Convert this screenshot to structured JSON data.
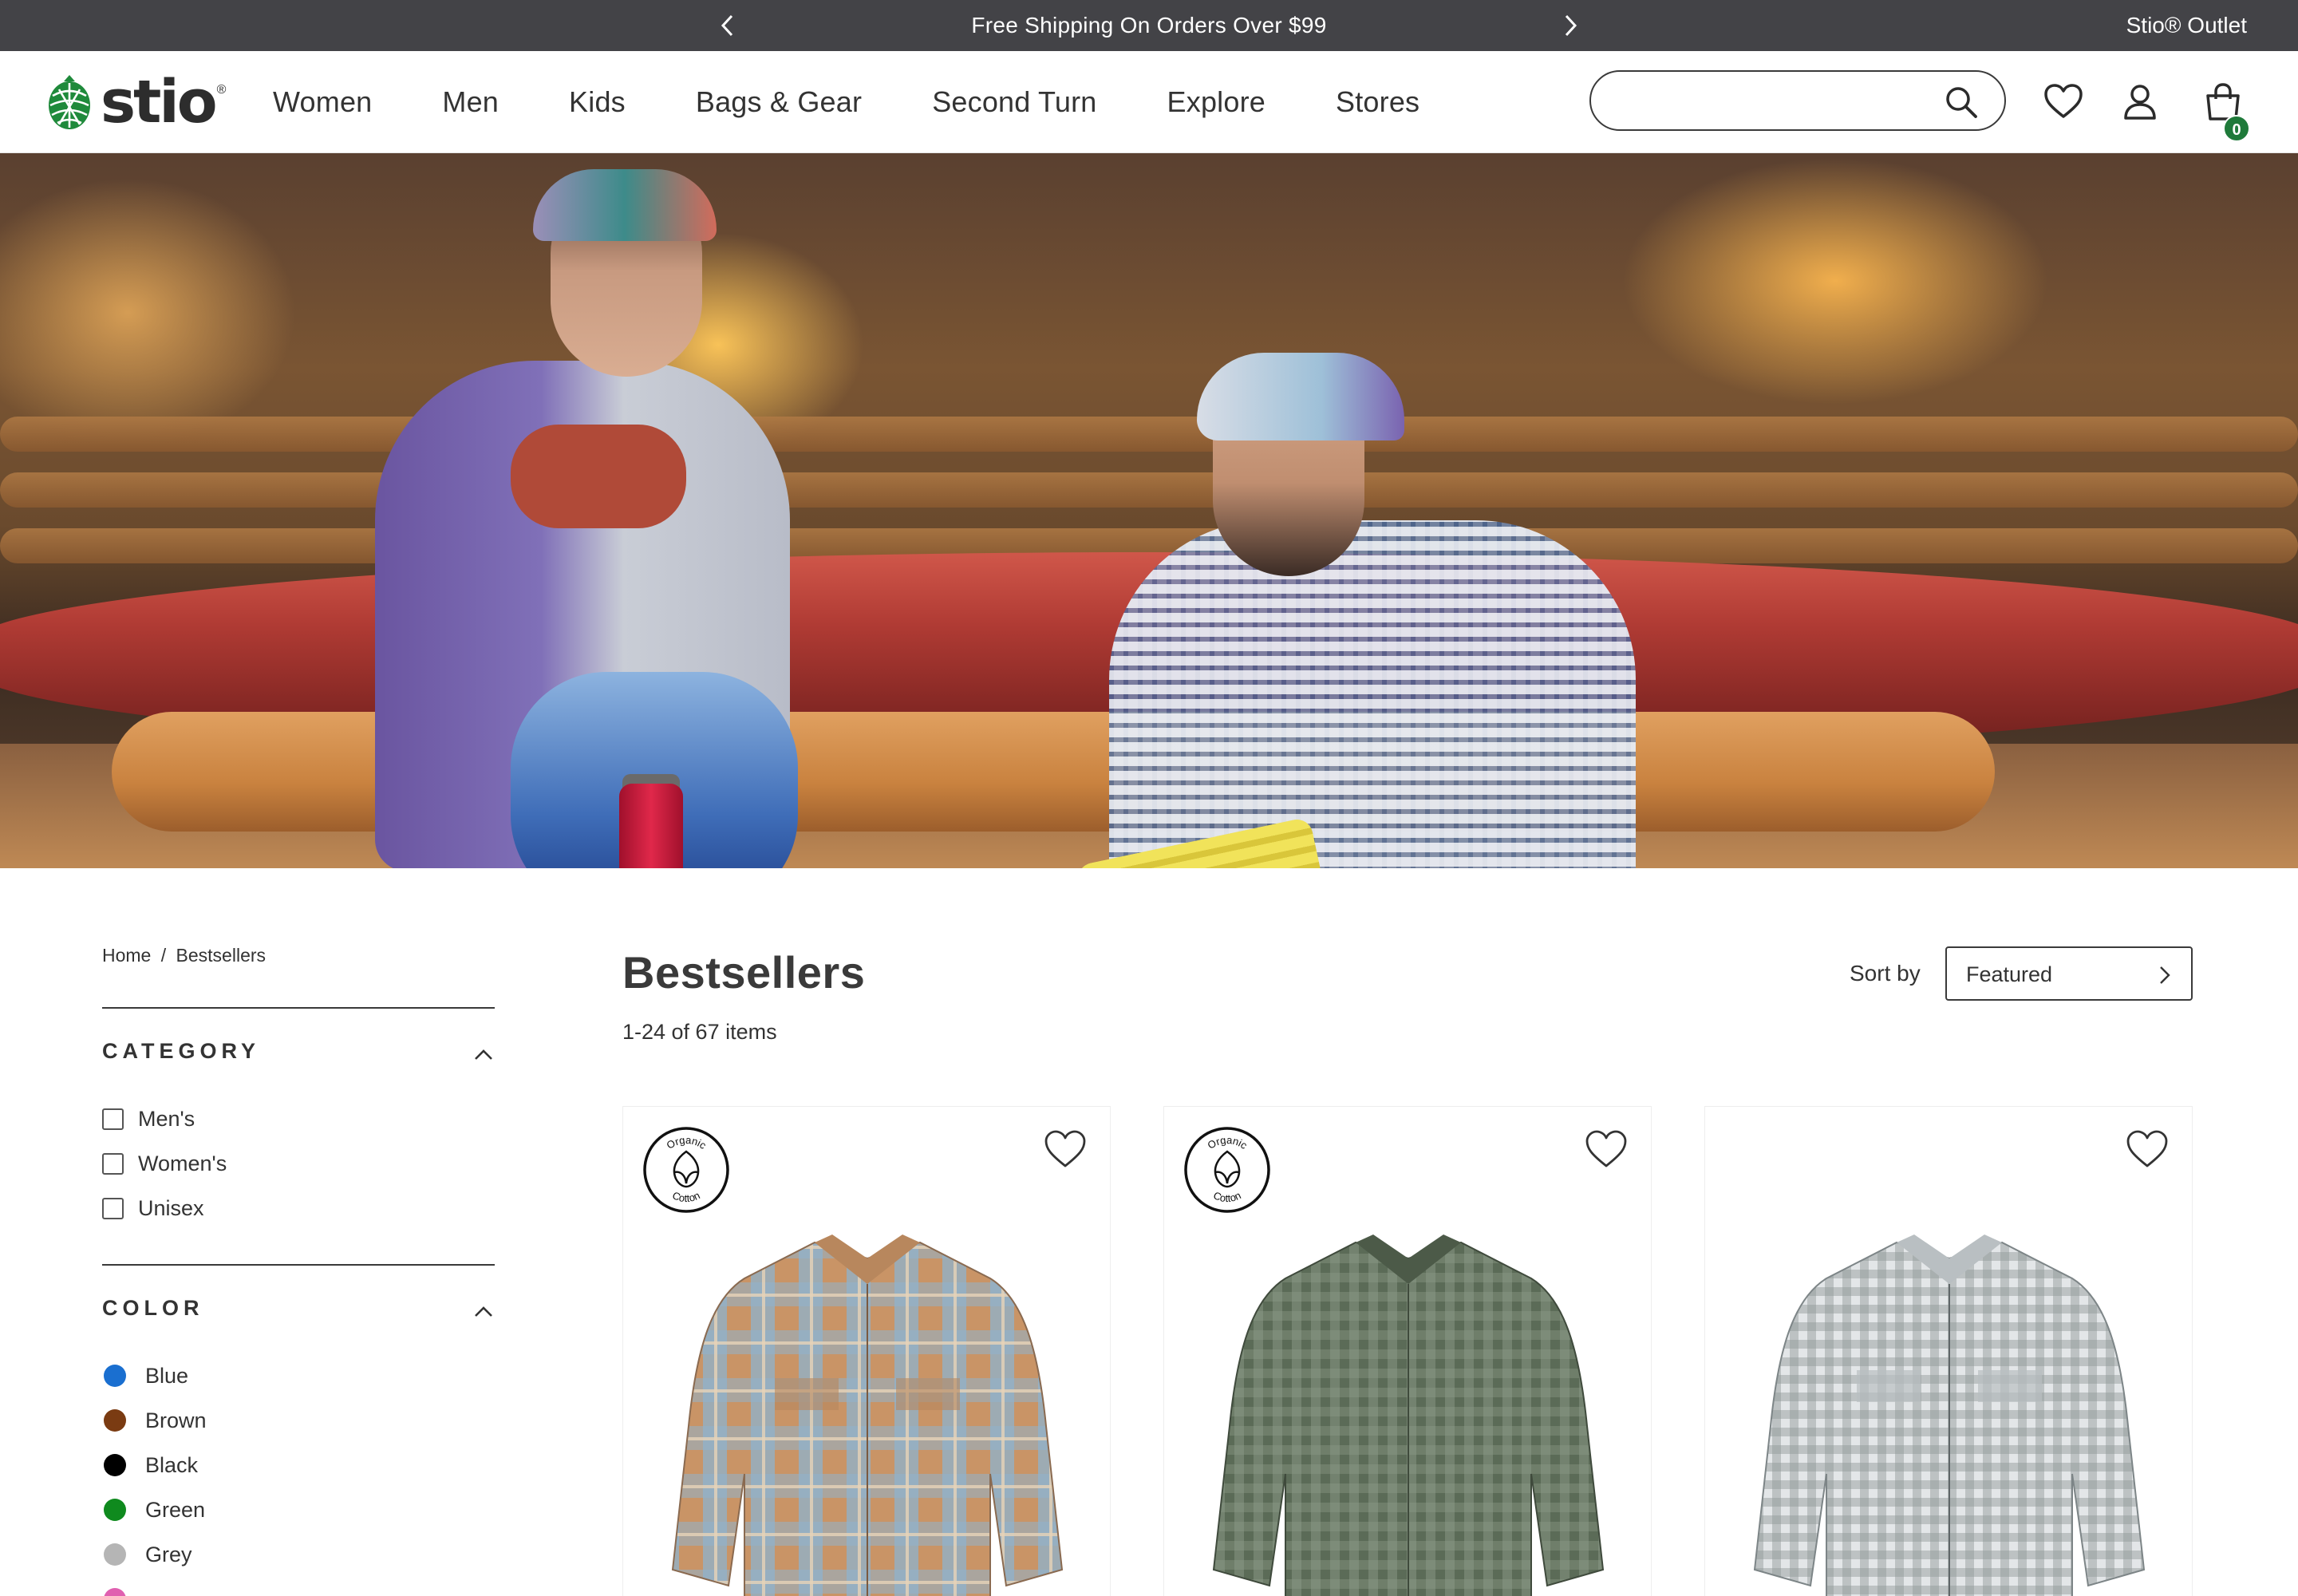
{
  "promo": {
    "message": "Free Shipping On Orders Over $99",
    "outlet_link": "Stio® Outlet"
  },
  "header": {
    "logo_text": "stio",
    "logo_mark": "®",
    "nav": [
      "Women",
      "Men",
      "Kids",
      "Bags & Gear",
      "Second Turn",
      "Explore",
      "Stores"
    ],
    "search": {
      "value": "",
      "placeholder": ""
    },
    "cart_count": "0",
    "icons": [
      "search-icon",
      "heart-icon",
      "user-icon",
      "shopping-bag-icon"
    ]
  },
  "breadcrumb": {
    "home": "Home",
    "separator": "/",
    "current": "Bestsellers"
  },
  "filters": {
    "category": {
      "title": "CATEGORY",
      "options": [
        "Men's",
        "Women's",
        "Unisex"
      ]
    },
    "color": {
      "title": "COLOR",
      "options": [
        {
          "label": "Blue",
          "color": "#1a6fd0"
        },
        {
          "label": "Brown",
          "color": "#7a3b12"
        },
        {
          "label": "Black",
          "color": "#000000"
        },
        {
          "label": "Green",
          "color": "#0f8a1e"
        },
        {
          "label": "Grey",
          "color": "#b5b5b5"
        }
      ]
    }
  },
  "listing": {
    "title": "Bestsellers",
    "count": "1-24 of 67 items",
    "sort_label": "Sort by",
    "sort_value": "Featured"
  },
  "products": [
    {
      "badge": {
        "top": "Organic",
        "bottom": "Cotton"
      },
      "colors": [
        "#c99466",
        "#8fb2cc"
      ]
    },
    {
      "badge": {
        "top": "Organic",
        "bottom": "Cotton"
      },
      "colors": [
        "#5b6b57",
        "#8c9a88"
      ]
    },
    {
      "badge": null,
      "colors": [
        "#e3e6e8",
        "#8e9698"
      ]
    }
  ]
}
